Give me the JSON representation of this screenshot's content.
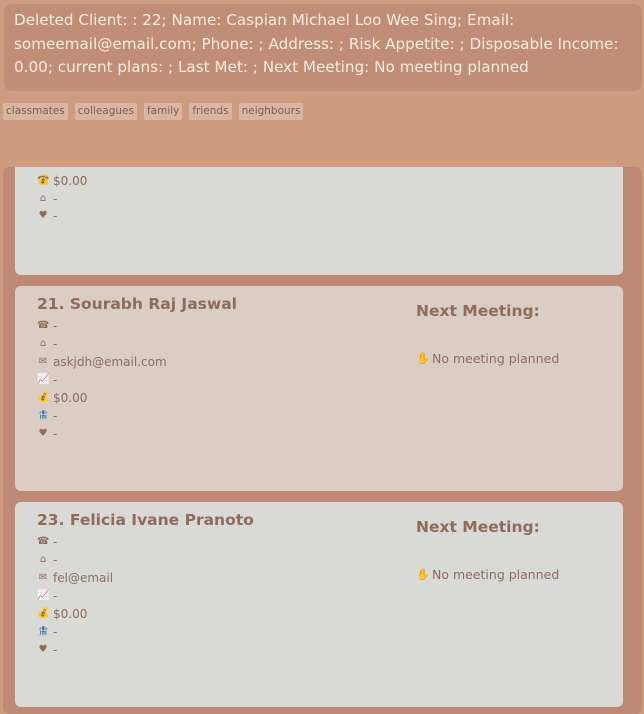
{
  "result": {
    "message": "Deleted Client: : 22; Name: Caspian Michael Loo Wee Sing; Email: someemail@email.com; Phone: ; Address: ; Risk Appetite: ; Disposable Income: 0.00; current plans: ; Last Met: ; Next Meeting: No meeting planned"
  },
  "tags": [
    "classmates",
    "colleagues",
    "family",
    "friends",
    "neighbours"
  ],
  "partial_card": {
    "income": "$0.00",
    "plans": "-",
    "risk": "-"
  },
  "cards": [
    {
      "title": "21.  Sourabh Raj Jaswal",
      "phone": "-",
      "address": "-",
      "email": "askjdh@email.com",
      "risk": "-",
      "income": "$0.00",
      "plans": "-",
      "last_met": "-",
      "meeting_label": "Next Meeting:",
      "meeting_value": "No meeting planned"
    },
    {
      "title": "23.  Felicia Ivane Pranoto",
      "phone": "-",
      "address": "-",
      "email": "fel@email",
      "risk": "-",
      "income": "$0.00",
      "plans": "-",
      "last_met": "-",
      "meeting_label": "Next Meeting:",
      "meeting_value": "No meeting planned"
    }
  ],
  "icons": {
    "phone": "phone-icon",
    "home": "home-icon",
    "email": "email-icon",
    "risk": "chart-icon",
    "income": "money-bag-icon",
    "plans": "plans-icon",
    "last_met": "heart-icon",
    "meeting": "hand-icon"
  }
}
